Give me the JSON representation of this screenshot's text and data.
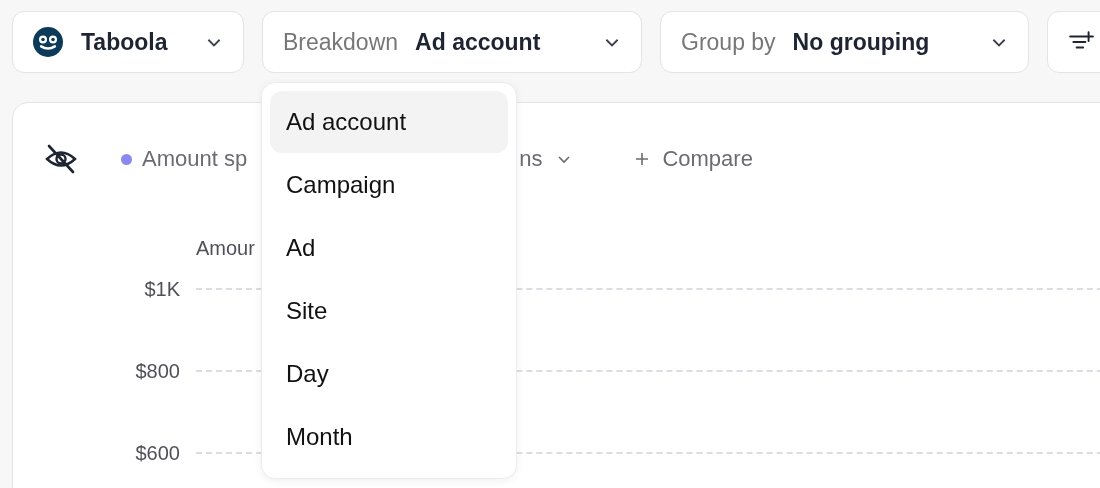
{
  "toolbar": {
    "account": {
      "label": "Taboola"
    },
    "breakdown": {
      "label": "Breakdown",
      "value": "Ad account"
    },
    "group_by": {
      "label": "Group by",
      "value": "No grouping"
    }
  },
  "chart": {
    "legend": {
      "label": "Amount sp",
      "color": "#8b87f0"
    },
    "metric_selector": {
      "label": "ns"
    },
    "compare": {
      "label": "Compare"
    },
    "title": "Amour",
    "y_labels": [
      "$1K",
      "$800",
      "$600"
    ]
  },
  "breakdown_menu": {
    "items": [
      {
        "label": "Ad account",
        "selected": true
      },
      {
        "label": "Campaign",
        "selected": false
      },
      {
        "label": "Ad",
        "selected": false
      },
      {
        "label": "Site",
        "selected": false
      },
      {
        "label": "Day",
        "selected": false
      },
      {
        "label": "Month",
        "selected": false
      }
    ]
  }
}
